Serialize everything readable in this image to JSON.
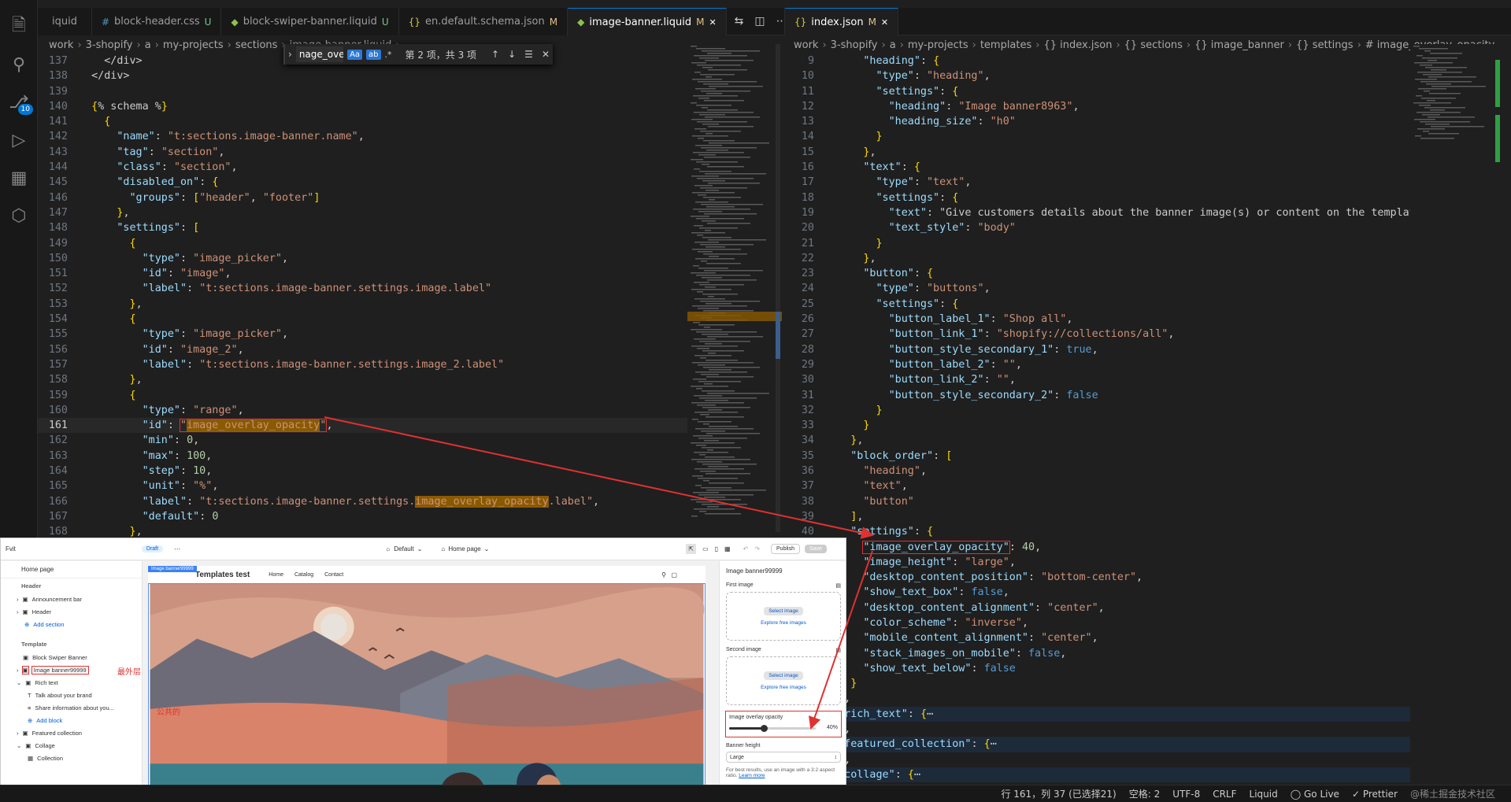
{
  "left_tabs": [
    {
      "icon": "",
      "label": "iquid",
      "state": ""
    },
    {
      "icon": "#",
      "label": "block-header.css",
      "state": "U"
    },
    {
      "icon": "S",
      "label": "block-swiper-banner.liquid",
      "state": "U"
    },
    {
      "icon": "{}",
      "label": "en.default.schema.json",
      "state": "M"
    },
    {
      "icon": "S",
      "label": "image-banner.liquid",
      "state": "M"
    }
  ],
  "right_tabs": [
    {
      "icon": "{}",
      "label": "index.json",
      "state": "M"
    }
  ],
  "left_breadcrumb": [
    "work",
    "3-shopify",
    "a",
    "my-projects",
    "sections",
    "image-banner.liquid",
    "..."
  ],
  "right_breadcrumb": [
    "work",
    "3-shopify",
    "a",
    "my-projects",
    "templates",
    "{} index.json",
    "{} sections",
    "{} image_banner",
    "{} settings",
    "# image_overlay_opacity"
  ],
  "find_widget": {
    "query": "nage_overlay_opacity",
    "case_label": "Aa",
    "word_label": "ab",
    "regex_label": ".*",
    "result": "第 2 项，共 3 项"
  },
  "left_code": [
    {
      "n": "137",
      "t": "    </div>"
    },
    {
      "n": "138",
      "t": "  </div>"
    },
    {
      "n": "139",
      "t": ""
    },
    {
      "n": "140",
      "t": "  {% schema %}"
    },
    {
      "n": "141",
      "t": "    {"
    },
    {
      "n": "142",
      "t": "      \"name\": \"t:sections.image-banner.name\","
    },
    {
      "n": "143",
      "t": "      \"tag\": \"section\","
    },
    {
      "n": "144",
      "t": "      \"class\": \"section\","
    },
    {
      "n": "145",
      "t": "      \"disabled_on\": {"
    },
    {
      "n": "146",
      "t": "        \"groups\": [\"header\", \"footer\"]"
    },
    {
      "n": "147",
      "t": "      },"
    },
    {
      "n": "148",
      "t": "      \"settings\": ["
    },
    {
      "n": "149",
      "t": "        {"
    },
    {
      "n": "150",
      "t": "          \"type\": \"image_picker\","
    },
    {
      "n": "151",
      "t": "          \"id\": \"image\","
    },
    {
      "n": "152",
      "t": "          \"label\": \"t:sections.image-banner.settings.image.label\""
    },
    {
      "n": "153",
      "t": "        },"
    },
    {
      "n": "154",
      "t": "        {"
    },
    {
      "n": "155",
      "t": "          \"type\": \"image_picker\","
    },
    {
      "n": "156",
      "t": "          \"id\": \"image_2\","
    },
    {
      "n": "157",
      "t": "          \"label\": \"t:sections.image-banner.settings.image_2.label\""
    },
    {
      "n": "158",
      "t": "        },"
    },
    {
      "n": "159",
      "t": "        {"
    },
    {
      "n": "160",
      "t": "          \"type\": \"range\","
    },
    {
      "n": "161",
      "t": "          \"id\": \"image_overlay_opacity\","
    },
    {
      "n": "162",
      "t": "          \"min\": 0,"
    },
    {
      "n": "163",
      "t": "          \"max\": 100,"
    },
    {
      "n": "164",
      "t": "          \"step\": 10,"
    },
    {
      "n": "165",
      "t": "          \"unit\": \"%\","
    },
    {
      "n": "166",
      "t": "          \"label\": \"t:sections.image-banner.settings.image_overlay_opacity.label\","
    },
    {
      "n": "167",
      "t": "          \"default\": 0"
    },
    {
      "n": "168",
      "t": "        },"
    }
  ],
  "right_code": [
    {
      "n": "9",
      "t": "      \"heading\": {"
    },
    {
      "n": "10",
      "t": "        \"type\": \"heading\","
    },
    {
      "n": "11",
      "t": "        \"settings\": {"
    },
    {
      "n": "12",
      "t": "          \"heading\": \"Image banner8963\","
    },
    {
      "n": "13",
      "t": "          \"heading_size\": \"h0\""
    },
    {
      "n": "14",
      "t": "        }"
    },
    {
      "n": "15",
      "t": "      },"
    },
    {
      "n": "16",
      "t": "      \"text\": {"
    },
    {
      "n": "17",
      "t": "        \"type\": \"text\","
    },
    {
      "n": "18",
      "t": "        \"settings\": {"
    },
    {
      "n": "19",
      "t": "          \"text\": \"Give customers details about the banner image(s) or content on the template"
    },
    {
      "n": "20",
      "t": "          \"text_style\": \"body\""
    },
    {
      "n": "21",
      "t": "        }"
    },
    {
      "n": "22",
      "t": "      },"
    },
    {
      "n": "23",
      "t": "      \"button\": {"
    },
    {
      "n": "24",
      "t": "        \"type\": \"buttons\","
    },
    {
      "n": "25",
      "t": "        \"settings\": {"
    },
    {
      "n": "26",
      "t": "          \"button_label_1\": \"Shop all\","
    },
    {
      "n": "27",
      "t": "          \"button_link_1\": \"shopify://collections/all\","
    },
    {
      "n": "28",
      "t": "          \"button_style_secondary_1\": true,"
    },
    {
      "n": "29",
      "t": "          \"button_label_2\": \"\","
    },
    {
      "n": "30",
      "t": "          \"button_link_2\": \"\","
    },
    {
      "n": "31",
      "t": "          \"button_style_secondary_2\": false"
    },
    {
      "n": "32",
      "t": "        }"
    },
    {
      "n": "33",
      "t": "      }"
    },
    {
      "n": "34",
      "t": "    },"
    },
    {
      "n": "35",
      "t": "    \"block_order\": ["
    },
    {
      "n": "36",
      "t": "      \"heading\","
    },
    {
      "n": "37",
      "t": "      \"text\","
    },
    {
      "n": "38",
      "t": "      \"button\""
    },
    {
      "n": "39",
      "t": "    ],"
    },
    {
      "n": "40",
      "t": "    \"settings\": {"
    },
    {
      "n": "",
      "t": "      \"image_overlay_opacity\": 40,"
    },
    {
      "n": "",
      "t": "      \"image_height\": \"large\","
    },
    {
      "n": "",
      "t": "      \"desktop_content_position\": \"bottom-center\","
    },
    {
      "n": "",
      "t": "      \"show_text_box\": false,"
    },
    {
      "n": "",
      "t": "      \"desktop_content_alignment\": \"center\","
    },
    {
      "n": "",
      "t": "      \"color_scheme\": \"inverse\","
    },
    {
      "n": "",
      "t": "      \"mobile_content_alignment\": \"center\","
    },
    {
      "n": "",
      "t": "      \"stack_images_on_mobile\": false,"
    },
    {
      "n": "",
      "t": "      \"show_text_below\": false"
    },
    {
      "n": "",
      "t": "    }"
    },
    {
      "n": "",
      "t": "  },"
    },
    {
      "n": "",
      "t": "  \"rich_text\": {⋯"
    },
    {
      "n": "",
      "t": "  },"
    },
    {
      "n": "",
      "t": "  \"featured_collection\": {⋯"
    },
    {
      "n": "",
      "t": "  },"
    },
    {
      "n": "",
      "t": "  \"collage\": {⋯"
    },
    {
      "n": "",
      "t": "  },"
    }
  ],
  "status_bar": {
    "position": "行 161，列 37 (已选择21)",
    "spaces": "空格: 2",
    "encoding": "UTF-8",
    "eol": "CRLF",
    "language": "Liquid",
    "golive": "Go Live",
    "prettier": "Prettier",
    "watermark": "@稀土掘金技术社区"
  },
  "activity_bar": {
    "scm_badge": "10"
  },
  "shopify": {
    "store": "Fvit",
    "draft": "Draft",
    "theme": "Default",
    "page": "Home page",
    "publish": "Publish",
    "save": "Save",
    "left_title": "Home page",
    "header_group": "Header",
    "announcement": "Announcement bar",
    "header_item": "Header",
    "add_section": "Add section",
    "template_group": "Template",
    "block_swiper": "Block Swiper Banner",
    "image_banner_item": "Image banner99999",
    "annot_outer": "最外层",
    "annot_common": "公共的",
    "rich_text": "Rich text",
    "talk": "Talk about your brand",
    "share": "Share information about you...",
    "add_block": "Add block",
    "featured": "Featured collection",
    "collage": "Collage",
    "collection": "Collection",
    "canvas_tag": "Image banner99999",
    "site_title": "Templates test",
    "nav": [
      "Home",
      "Catalog",
      "Contact"
    ],
    "right_title": "Image banner99999",
    "first_image": "First image",
    "select_image": "Select image",
    "explore": "Explore free images",
    "second_image": "Second image",
    "overlay_label": "Image overlay opacity",
    "overlay_value": "40%",
    "overlay_fraction": 0.4,
    "banner_height": "Banner height",
    "banner_height_value": "Large",
    "hint": "For best results, use an image with a 3:2 aspect ratio.",
    "learn": "Learn more"
  }
}
